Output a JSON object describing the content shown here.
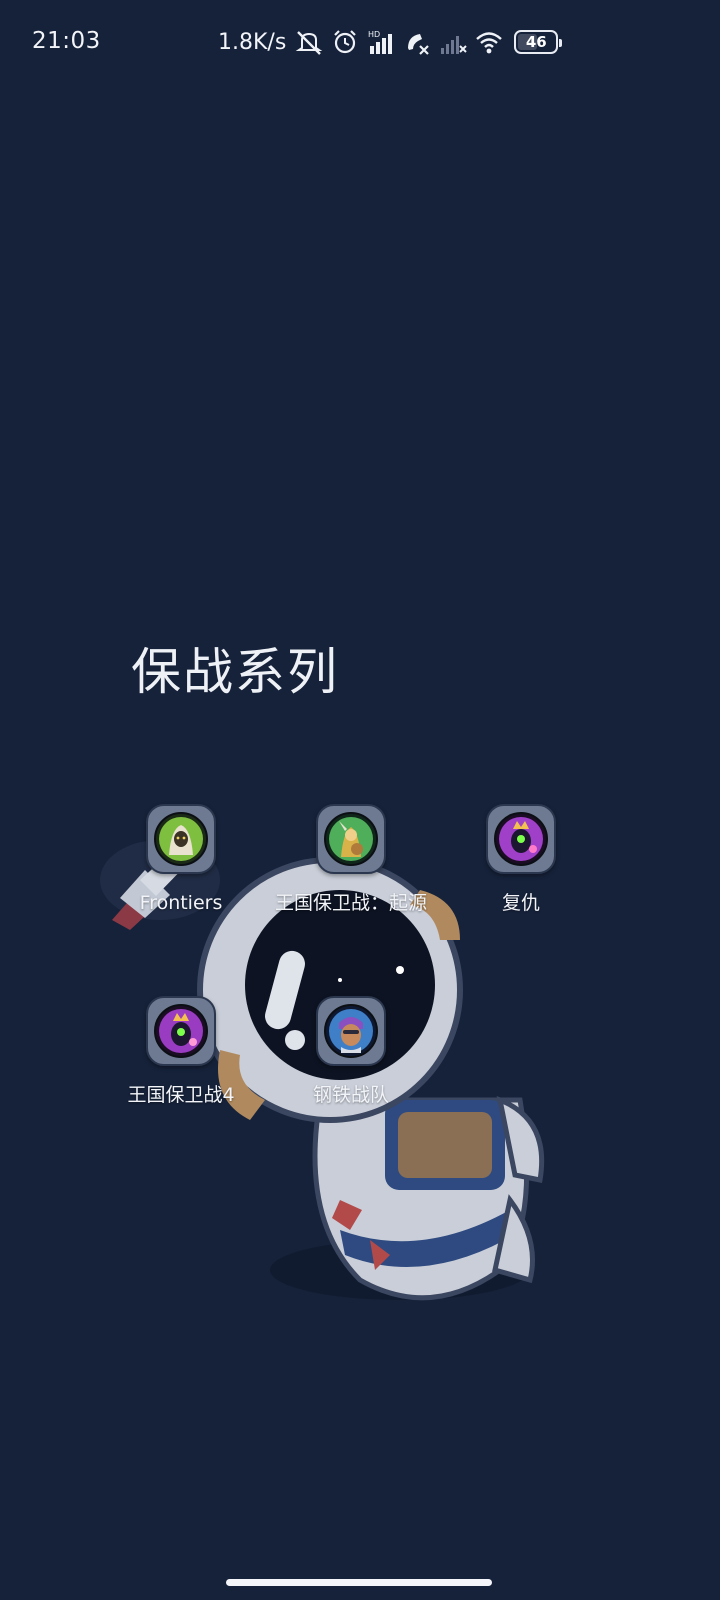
{
  "status_bar": {
    "time": "21:03",
    "net_speed": "1.8K/s",
    "battery_level": "46",
    "icons": [
      "mute-bell-icon",
      "alarm-icon",
      "hd-signal-icon",
      "call-blocked-icon",
      "signal-no-service-icon",
      "wifi-icon",
      "battery-icon"
    ]
  },
  "folder": {
    "title": "保战系列",
    "apps": [
      {
        "label": "Frontiers",
        "icon": "frontiers-game-icon",
        "accent": "#7fbf3f"
      },
      {
        "label": "王国保卫战：起源",
        "icon": "origins-game-icon",
        "accent": "#4fae5a"
      },
      {
        "label": "复仇",
        "icon": "vengeance-game-icon",
        "accent": "#a040c8"
      },
      {
        "label": "王国保卫战4",
        "icon": "kingdom-rush-4-icon",
        "accent": "#9a3cc2"
      },
      {
        "label": "钢铁战队",
        "icon": "iron-marines-icon",
        "accent": "#3f7fc8"
      }
    ]
  },
  "colors": {
    "background": "#16223a",
    "icon_tile": "#6d7a92",
    "text": "#f2f4f8"
  }
}
